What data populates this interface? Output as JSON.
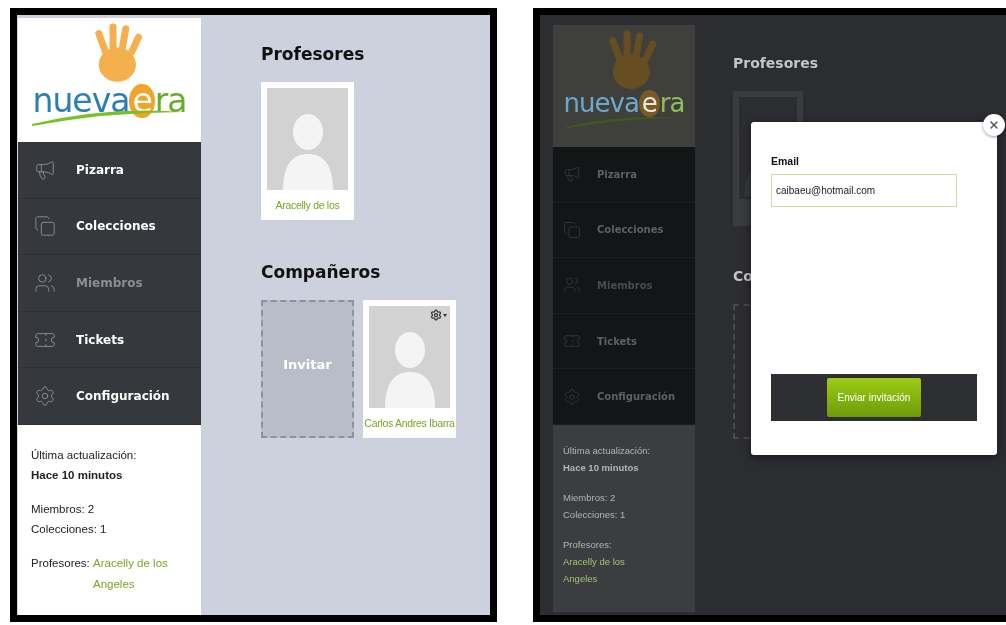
{
  "screens": [
    {
      "kind": "page",
      "logo": {
        "word": "nueva",
        "accent": "e",
        "rest": "ra"
      },
      "menu": [
        {
          "label": "Pizarra",
          "selected": false
        },
        {
          "label": "Colecciones",
          "selected": false
        },
        {
          "label": "Miembros",
          "selected": true
        },
        {
          "label": "Tickets",
          "selected": false
        },
        {
          "label": "Configuración",
          "selected": false
        }
      ],
      "info": {
        "updated_label": "Última actualización:",
        "updated_value": "Hace 10 minutos",
        "members": "Miembros: 2",
        "collections": "Colecciones: 1",
        "teachers_label": "Profesores:",
        "teachers_value": "Aracelly de los Angeles"
      },
      "sections": [
        {
          "title": "Profesores",
          "cards": [
            {
              "kind": "person",
              "name": "Aracelly de los",
              "menu": false
            }
          ]
        },
        {
          "title": "Compañeros",
          "cards": [
            {
              "kind": "invite",
              "label": "Invitar"
            },
            {
              "kind": "person",
              "name": "Carlos Andres Ibarra",
              "menu": true
            }
          ]
        }
      ]
    },
    {
      "kind": "dialog",
      "logo": {
        "word": "nueva",
        "accent": "e",
        "rest": "ra"
      },
      "menu": [
        {
          "label": "Pizarra",
          "selected": false
        },
        {
          "label": "Colecciones",
          "selected": false
        },
        {
          "label": "Miembros",
          "selected": true
        },
        {
          "label": "Tickets",
          "selected": false
        },
        {
          "label": "Configuración",
          "selected": false
        }
      ],
      "info": {
        "updated_label": "Última actualización:",
        "updated_value": "Hace 10 minutos",
        "members": "Miembros: 2",
        "collections": "Colecciones: 1",
        "teachers_label": "Profesores:",
        "teachers_value": "Aracelly de los Angeles"
      },
      "sections": [
        {
          "title": "Profesores",
          "cards": [
            {
              "kind": "person"
            }
          ]
        },
        {
          "title": "Co",
          "cards": [
            {
              "kind": "invite"
            }
          ]
        }
      ],
      "modal": {
        "label": "Email",
        "value": "caibaeu@hotmail.com",
        "button": "Enviar invitación"
      }
    }
  ]
}
